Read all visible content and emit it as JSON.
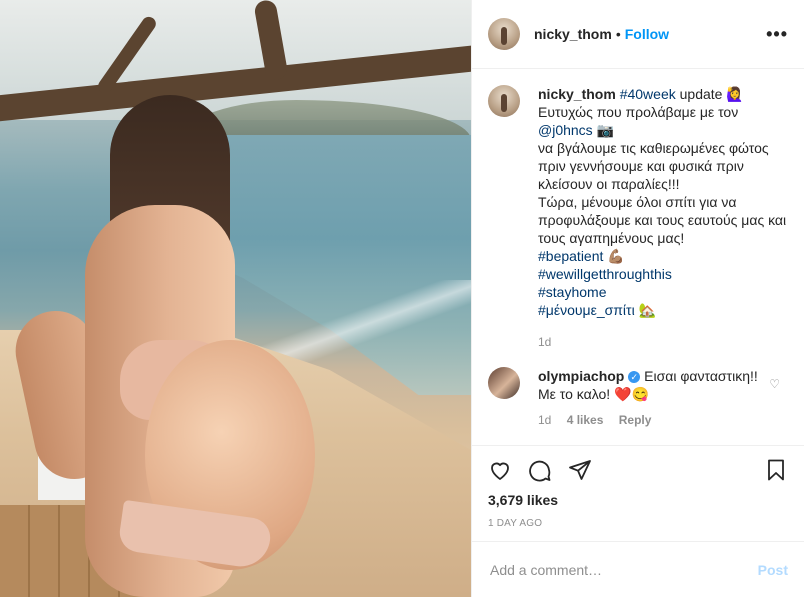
{
  "post": {
    "header": {
      "username": "nicky_thom",
      "separator": "•",
      "follow_label": "Follow",
      "more_label": "•••"
    },
    "caption": {
      "username": "nicky_thom",
      "hashtag_week": "#40week",
      "line1_rest": "update 🙋‍♀️",
      "line2": "Ευτυχώς που προλάβαμε με τον",
      "mention": "@j0hncs",
      "camera": "📷",
      "line3": "να βγάλουμε τις καθιερωμένες φώτος πριν γεννήσουμε και φυσικά πριν κλείσουν οι παραλίες!!!",
      "line4": "Τώρα, μένουμε όλοι σπίτι για να προφυλάξουμε και τους εαυτούς μας και τους αγαπημένους μας!",
      "tag1": "#bepatient",
      "tag1_emoji": "💪🏽",
      "tag2": "#wewillgetthroughthis",
      "tag3": "#stayhome",
      "tag4": "#μένουμε_σπίτι",
      "tag4_emoji": "🏡",
      "time": "1d"
    },
    "comment": {
      "username": "olympiachop",
      "verified": "✓",
      "text": "Εισαι φανταστικη!! Με το καλο! ❤️😋",
      "time": "1d",
      "likes": "4 likes",
      "reply": "Reply"
    },
    "likes": "3,679 likes",
    "ago": "1 DAY AGO",
    "add_comment": {
      "placeholder": "Add a comment…",
      "post_label": "Post"
    },
    "colors": {
      "link": "#0095f6",
      "tag": "#00376b",
      "muted": "#8e8e8e",
      "post_disabled": "#b3dbff"
    }
  }
}
